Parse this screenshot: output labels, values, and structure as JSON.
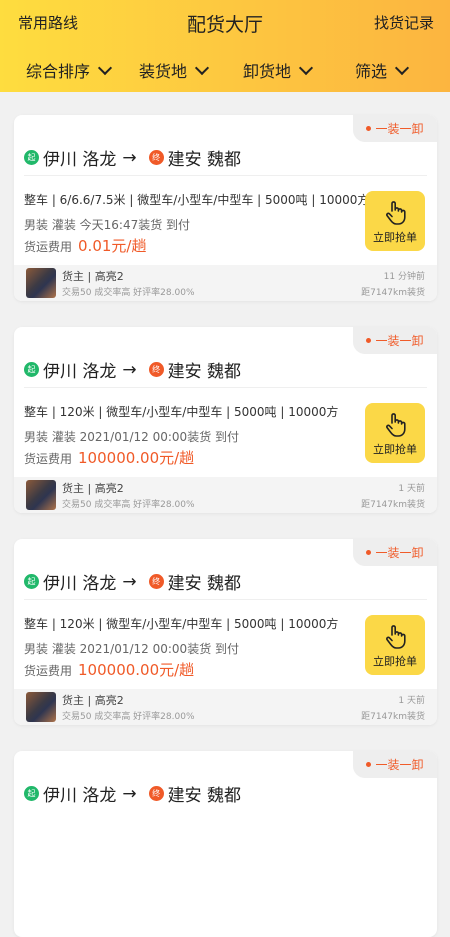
{
  "header": {
    "left": "常用路线",
    "title": "配货大厅",
    "right": "找货记录"
  },
  "filters": [
    "综合排序",
    "装货地",
    "卸货地",
    "筛选"
  ],
  "cards": [
    {
      "tag": "一装一卸",
      "start_badge": "起",
      "end_badge": "终",
      "from": "伊川 洛龙",
      "arrow": "→",
      "to": "建安 魏都",
      "spec": "整车 | 6/6.6/7.5米 | 微型车/小型车/中型车 | 5000吨 | 10000方",
      "load": "男装  灌装  今天16:47装货  到付",
      "fee_label": "货运费用",
      "price": "0.01元/趟",
      "button": "立即抢单",
      "owner": "货主 | 高亮2",
      "stats": "交易50  成交率高  好评率28.00%",
      "ago": "11 分钟前",
      "distance": "距7147km装货"
    },
    {
      "tag": "一装一卸",
      "start_badge": "起",
      "end_badge": "终",
      "from": "伊川 洛龙",
      "arrow": "→",
      "to": "建安 魏都",
      "spec": "整车 | 120米 | 微型车/小型车/中型车 | 5000吨 | 10000方",
      "load": "男装  灌装  2021/01/12 00:00装货  到付",
      "fee_label": "货运费用",
      "price": "100000.00元/趟",
      "button": "立即抢单",
      "owner": "货主 | 高亮2",
      "stats": "交易50  成交率高  好评率28.00%",
      "ago": "1 天前",
      "distance": "距7147km装货"
    },
    {
      "tag": "一装一卸",
      "start_badge": "起",
      "end_badge": "终",
      "from": "伊川 洛龙",
      "arrow": "→",
      "to": "建安 魏都",
      "spec": "整车 | 120米 | 微型车/小型车/中型车 | 5000吨 | 10000方",
      "load": "男装  灌装  2021/01/12 00:00装货  到付",
      "fee_label": "货运费用",
      "price": "100000.00元/趟",
      "button": "立即抢单",
      "owner": "货主 | 高亮2",
      "stats": "交易50  成交率高  好评率28.00%",
      "ago": "1 天前",
      "distance": "距7147km装货"
    },
    {
      "tag": "一装一卸",
      "start_badge": "起",
      "end_badge": "终",
      "from": "伊川 洛龙",
      "arrow": "→",
      "to": "建安 魏都",
      "spec": "",
      "load": "",
      "fee_label": "",
      "price": "",
      "button": "",
      "owner": "",
      "stats": "",
      "ago": "",
      "distance": ""
    }
  ]
}
